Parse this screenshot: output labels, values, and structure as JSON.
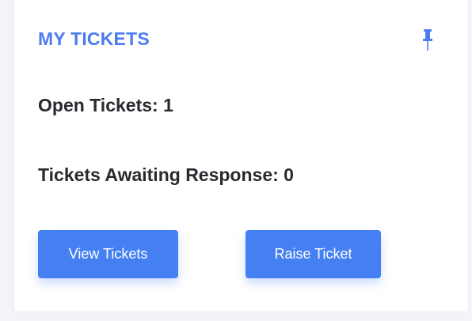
{
  "widget": {
    "title": "MY TICKETS",
    "pin_icon": "pin-icon",
    "accent_color": "#4a7cf0",
    "button_color": "#4580f3"
  },
  "stats": {
    "open_tickets": "Open Tickets: 1",
    "awaiting_response": "Tickets Awaiting Response: 0"
  },
  "actions": {
    "view_label": "View Tickets",
    "raise_label": "Raise Ticket"
  }
}
